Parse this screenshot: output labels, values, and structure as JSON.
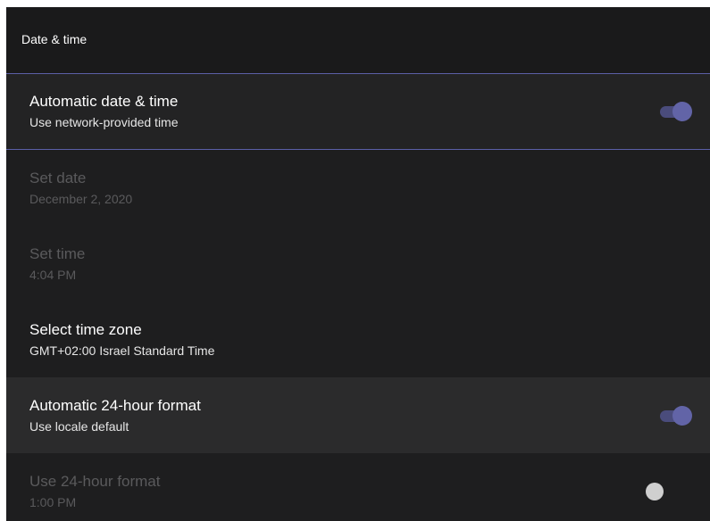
{
  "header": {
    "title": "Date & time"
  },
  "settings": [
    {
      "title": "Automatic date & time",
      "subtitle": "Use network-provided time",
      "toggle": "on",
      "enabled": true
    },
    {
      "title": "Set date",
      "subtitle": "December 2, 2020",
      "enabled": false
    },
    {
      "title": "Set time",
      "subtitle": "4:04 PM",
      "enabled": false
    },
    {
      "title": "Select time zone",
      "subtitle": "GMT+02:00 Israel Standard Time",
      "enabled": true
    },
    {
      "title": "Automatic 24-hour format",
      "subtitle": "Use locale default",
      "toggle": "on",
      "enabled": true
    },
    {
      "title": "Use 24-hour format",
      "subtitle": "1:00 PM",
      "toggle": "off",
      "enabled": false
    }
  ],
  "colors": {
    "background": "#1e1e1f",
    "accent": "#6264a7",
    "divider": "#5b5fa7",
    "disabled_text": "#5a5a5c"
  }
}
